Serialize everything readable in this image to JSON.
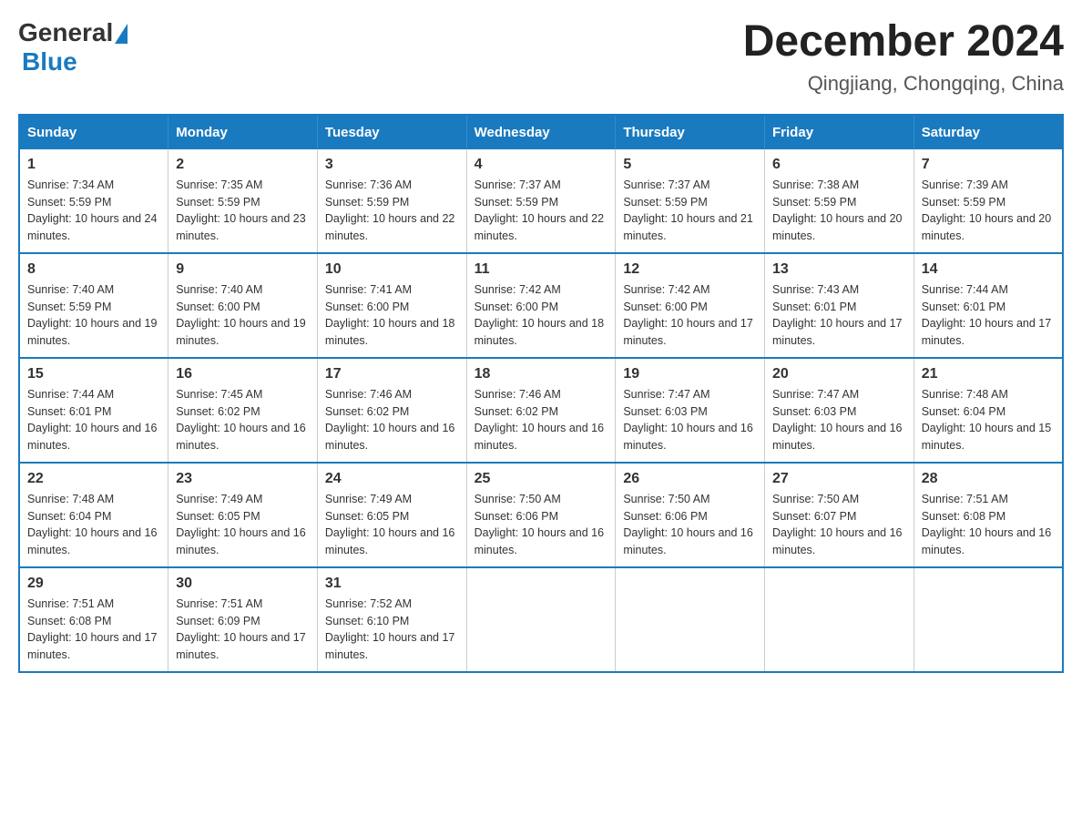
{
  "header": {
    "logo": {
      "general": "General",
      "blue": "Blue"
    },
    "title": "December 2024",
    "subtitle": "Qingjiang, Chongqing, China"
  },
  "weekdays": [
    "Sunday",
    "Monday",
    "Tuesday",
    "Wednesday",
    "Thursday",
    "Friday",
    "Saturday"
  ],
  "weeks": [
    [
      {
        "day": "1",
        "sunrise": "7:34 AM",
        "sunset": "5:59 PM",
        "daylight": "10 hours and 24 minutes."
      },
      {
        "day": "2",
        "sunrise": "7:35 AM",
        "sunset": "5:59 PM",
        "daylight": "10 hours and 23 minutes."
      },
      {
        "day": "3",
        "sunrise": "7:36 AM",
        "sunset": "5:59 PM",
        "daylight": "10 hours and 22 minutes."
      },
      {
        "day": "4",
        "sunrise": "7:37 AM",
        "sunset": "5:59 PM",
        "daylight": "10 hours and 22 minutes."
      },
      {
        "day": "5",
        "sunrise": "7:37 AM",
        "sunset": "5:59 PM",
        "daylight": "10 hours and 21 minutes."
      },
      {
        "day": "6",
        "sunrise": "7:38 AM",
        "sunset": "5:59 PM",
        "daylight": "10 hours and 20 minutes."
      },
      {
        "day": "7",
        "sunrise": "7:39 AM",
        "sunset": "5:59 PM",
        "daylight": "10 hours and 20 minutes."
      }
    ],
    [
      {
        "day": "8",
        "sunrise": "7:40 AM",
        "sunset": "5:59 PM",
        "daylight": "10 hours and 19 minutes."
      },
      {
        "day": "9",
        "sunrise": "7:40 AM",
        "sunset": "6:00 PM",
        "daylight": "10 hours and 19 minutes."
      },
      {
        "day": "10",
        "sunrise": "7:41 AM",
        "sunset": "6:00 PM",
        "daylight": "10 hours and 18 minutes."
      },
      {
        "day": "11",
        "sunrise": "7:42 AM",
        "sunset": "6:00 PM",
        "daylight": "10 hours and 18 minutes."
      },
      {
        "day": "12",
        "sunrise": "7:42 AM",
        "sunset": "6:00 PM",
        "daylight": "10 hours and 17 minutes."
      },
      {
        "day": "13",
        "sunrise": "7:43 AM",
        "sunset": "6:01 PM",
        "daylight": "10 hours and 17 minutes."
      },
      {
        "day": "14",
        "sunrise": "7:44 AM",
        "sunset": "6:01 PM",
        "daylight": "10 hours and 17 minutes."
      }
    ],
    [
      {
        "day": "15",
        "sunrise": "7:44 AM",
        "sunset": "6:01 PM",
        "daylight": "10 hours and 16 minutes."
      },
      {
        "day": "16",
        "sunrise": "7:45 AM",
        "sunset": "6:02 PM",
        "daylight": "10 hours and 16 minutes."
      },
      {
        "day": "17",
        "sunrise": "7:46 AM",
        "sunset": "6:02 PM",
        "daylight": "10 hours and 16 minutes."
      },
      {
        "day": "18",
        "sunrise": "7:46 AM",
        "sunset": "6:02 PM",
        "daylight": "10 hours and 16 minutes."
      },
      {
        "day": "19",
        "sunrise": "7:47 AM",
        "sunset": "6:03 PM",
        "daylight": "10 hours and 16 minutes."
      },
      {
        "day": "20",
        "sunrise": "7:47 AM",
        "sunset": "6:03 PM",
        "daylight": "10 hours and 16 minutes."
      },
      {
        "day": "21",
        "sunrise": "7:48 AM",
        "sunset": "6:04 PM",
        "daylight": "10 hours and 15 minutes."
      }
    ],
    [
      {
        "day": "22",
        "sunrise": "7:48 AM",
        "sunset": "6:04 PM",
        "daylight": "10 hours and 16 minutes."
      },
      {
        "day": "23",
        "sunrise": "7:49 AM",
        "sunset": "6:05 PM",
        "daylight": "10 hours and 16 minutes."
      },
      {
        "day": "24",
        "sunrise": "7:49 AM",
        "sunset": "6:05 PM",
        "daylight": "10 hours and 16 minutes."
      },
      {
        "day": "25",
        "sunrise": "7:50 AM",
        "sunset": "6:06 PM",
        "daylight": "10 hours and 16 minutes."
      },
      {
        "day": "26",
        "sunrise": "7:50 AM",
        "sunset": "6:06 PM",
        "daylight": "10 hours and 16 minutes."
      },
      {
        "day": "27",
        "sunrise": "7:50 AM",
        "sunset": "6:07 PM",
        "daylight": "10 hours and 16 minutes."
      },
      {
        "day": "28",
        "sunrise": "7:51 AM",
        "sunset": "6:08 PM",
        "daylight": "10 hours and 16 minutes."
      }
    ],
    [
      {
        "day": "29",
        "sunrise": "7:51 AM",
        "sunset": "6:08 PM",
        "daylight": "10 hours and 17 minutes."
      },
      {
        "day": "30",
        "sunrise": "7:51 AM",
        "sunset": "6:09 PM",
        "daylight": "10 hours and 17 minutes."
      },
      {
        "day": "31",
        "sunrise": "7:52 AM",
        "sunset": "6:10 PM",
        "daylight": "10 hours and 17 minutes."
      },
      null,
      null,
      null,
      null
    ]
  ]
}
